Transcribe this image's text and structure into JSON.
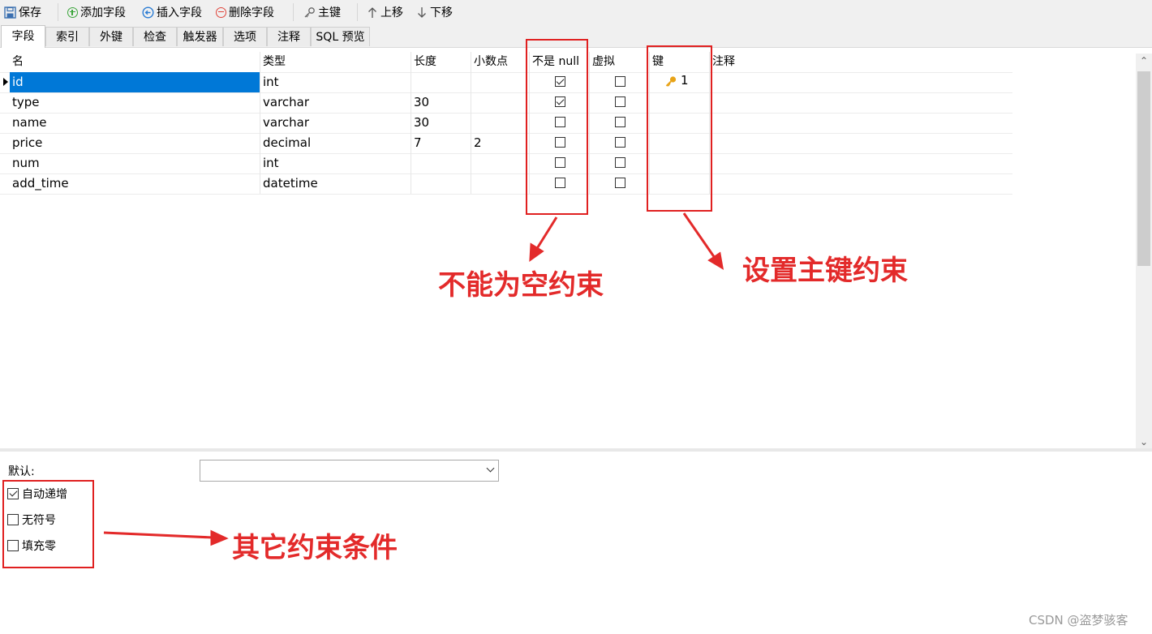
{
  "toolbar": {
    "save": "保存",
    "add_field": "添加字段",
    "insert_field": "插入字段",
    "delete_field": "删除字段",
    "primary_key": "主键",
    "move_up": "上移",
    "move_down": "下移"
  },
  "tabs": [
    "字段",
    "索引",
    "外键",
    "检查",
    "触发器",
    "选项",
    "注释",
    "SQL 预览"
  ],
  "grid": {
    "headers": {
      "name": "名",
      "type": "类型",
      "length": "长度",
      "decimals": "小数点",
      "not_null": "不是 null",
      "virtual": "虚拟",
      "key": "键",
      "comment": "注释"
    },
    "rows": [
      {
        "name": "id",
        "type": "int",
        "length": "",
        "decimals": "",
        "not_null": true,
        "virtual": false,
        "key": "1"
      },
      {
        "name": "type",
        "type": "varchar",
        "length": "30",
        "decimals": "",
        "not_null": true,
        "virtual": false,
        "key": ""
      },
      {
        "name": "name",
        "type": "varchar",
        "length": "30",
        "decimals": "",
        "not_null": false,
        "virtual": false,
        "key": ""
      },
      {
        "name": "price",
        "type": "decimal",
        "length": "7",
        "decimals": "2",
        "not_null": false,
        "virtual": false,
        "key": ""
      },
      {
        "name": "num",
        "type": "int",
        "length": "",
        "decimals": "",
        "not_null": false,
        "virtual": false,
        "key": ""
      },
      {
        "name": "add_time",
        "type": "datetime",
        "length": "",
        "decimals": "",
        "not_null": false,
        "virtual": false,
        "key": ""
      }
    ],
    "selected_row": 0
  },
  "bottom": {
    "default_label": "默认:",
    "default_value": "",
    "auto_increment": "自动递增",
    "auto_increment_checked": true,
    "unsigned": "无符号",
    "unsigned_checked": false,
    "zerofill": "填充零",
    "zerofill_checked": false
  },
  "annotations": {
    "not_null": "不能为空约束",
    "primary_key": "设置主键约束",
    "other": "其它约束条件"
  },
  "colors": {
    "annotation_red": "#e32a2a",
    "selection_blue": "#0078d7",
    "key_gold": "#e8a317"
  },
  "watermark": "CSDN @盗梦骇客"
}
